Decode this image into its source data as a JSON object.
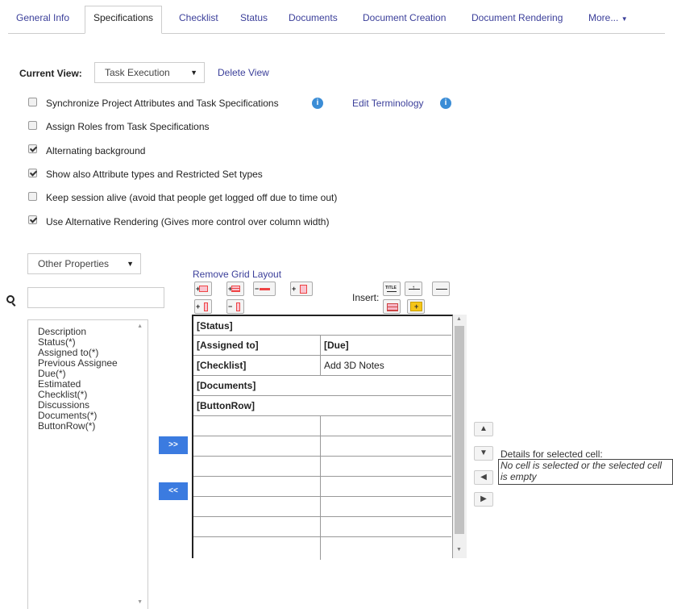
{
  "tabs": [
    {
      "label": "General Info",
      "active": false
    },
    {
      "label": "Specifications",
      "active": true
    },
    {
      "label": "Checklist",
      "active": false
    },
    {
      "label": "Status",
      "active": false
    },
    {
      "label": "Documents",
      "active": false
    },
    {
      "label": "Document Creation",
      "active": false
    },
    {
      "label": "Document Rendering",
      "active": false
    },
    {
      "label": "More...",
      "active": false
    }
  ],
  "view": {
    "label": "Current View:",
    "selected": "Task Execution",
    "delete_link": "Delete View"
  },
  "options": [
    {
      "label": "Synchronize Project Attributes and Task Specifications",
      "checked": false
    },
    {
      "label": "Assign Roles from Task Specifications",
      "checked": false
    },
    {
      "label": "Alternating background",
      "checked": true
    },
    {
      "label": "Show also Attribute types and Restricted Set types",
      "checked": true
    },
    {
      "label": "Keep session alive (avoid that people get logged off due to time out)",
      "checked": false
    },
    {
      "label": "Use Alternative Rendering (Gives more control over column width)",
      "checked": true
    }
  ],
  "edit_terminology": "Edit Terminology",
  "info_icon": "i",
  "properties_select": "Other Properties",
  "search": {
    "placeholder": ""
  },
  "property_list": [
    "Description",
    "Status(*)",
    "Assigned to(*)",
    "Previous Assignee",
    "Due(*)",
    "Estimated",
    "Checklist(*)",
    "Discussions",
    "Documents(*)",
    "ButtonRow(*)"
  ],
  "move_right": ">>",
  "move_left": "<<",
  "remove_grid_layout": "Remove Grid Layout",
  "insert_label": "Insert:",
  "grid_rows": [
    {
      "cells": [
        "[Status]"
      ],
      "bold": [
        true
      ]
    },
    {
      "cells": [
        "[Assigned to]",
        "[Due]"
      ],
      "bold": [
        true,
        true
      ]
    },
    {
      "cells": [
        "[Checklist]",
        "Add 3D Notes"
      ],
      "bold": [
        true,
        false
      ]
    },
    {
      "cells": [
        "[Documents]"
      ],
      "bold": [
        true
      ]
    },
    {
      "cells": [
        "[ButtonRow]"
      ],
      "bold": [
        true
      ]
    }
  ],
  "details": {
    "label": "Details for selected cell:",
    "text": "No cell is selected or the selected cell is empty"
  },
  "colors": {
    "link": "#3b3f9a",
    "button": "#3b7be0",
    "info": "#3b8dd6"
  }
}
